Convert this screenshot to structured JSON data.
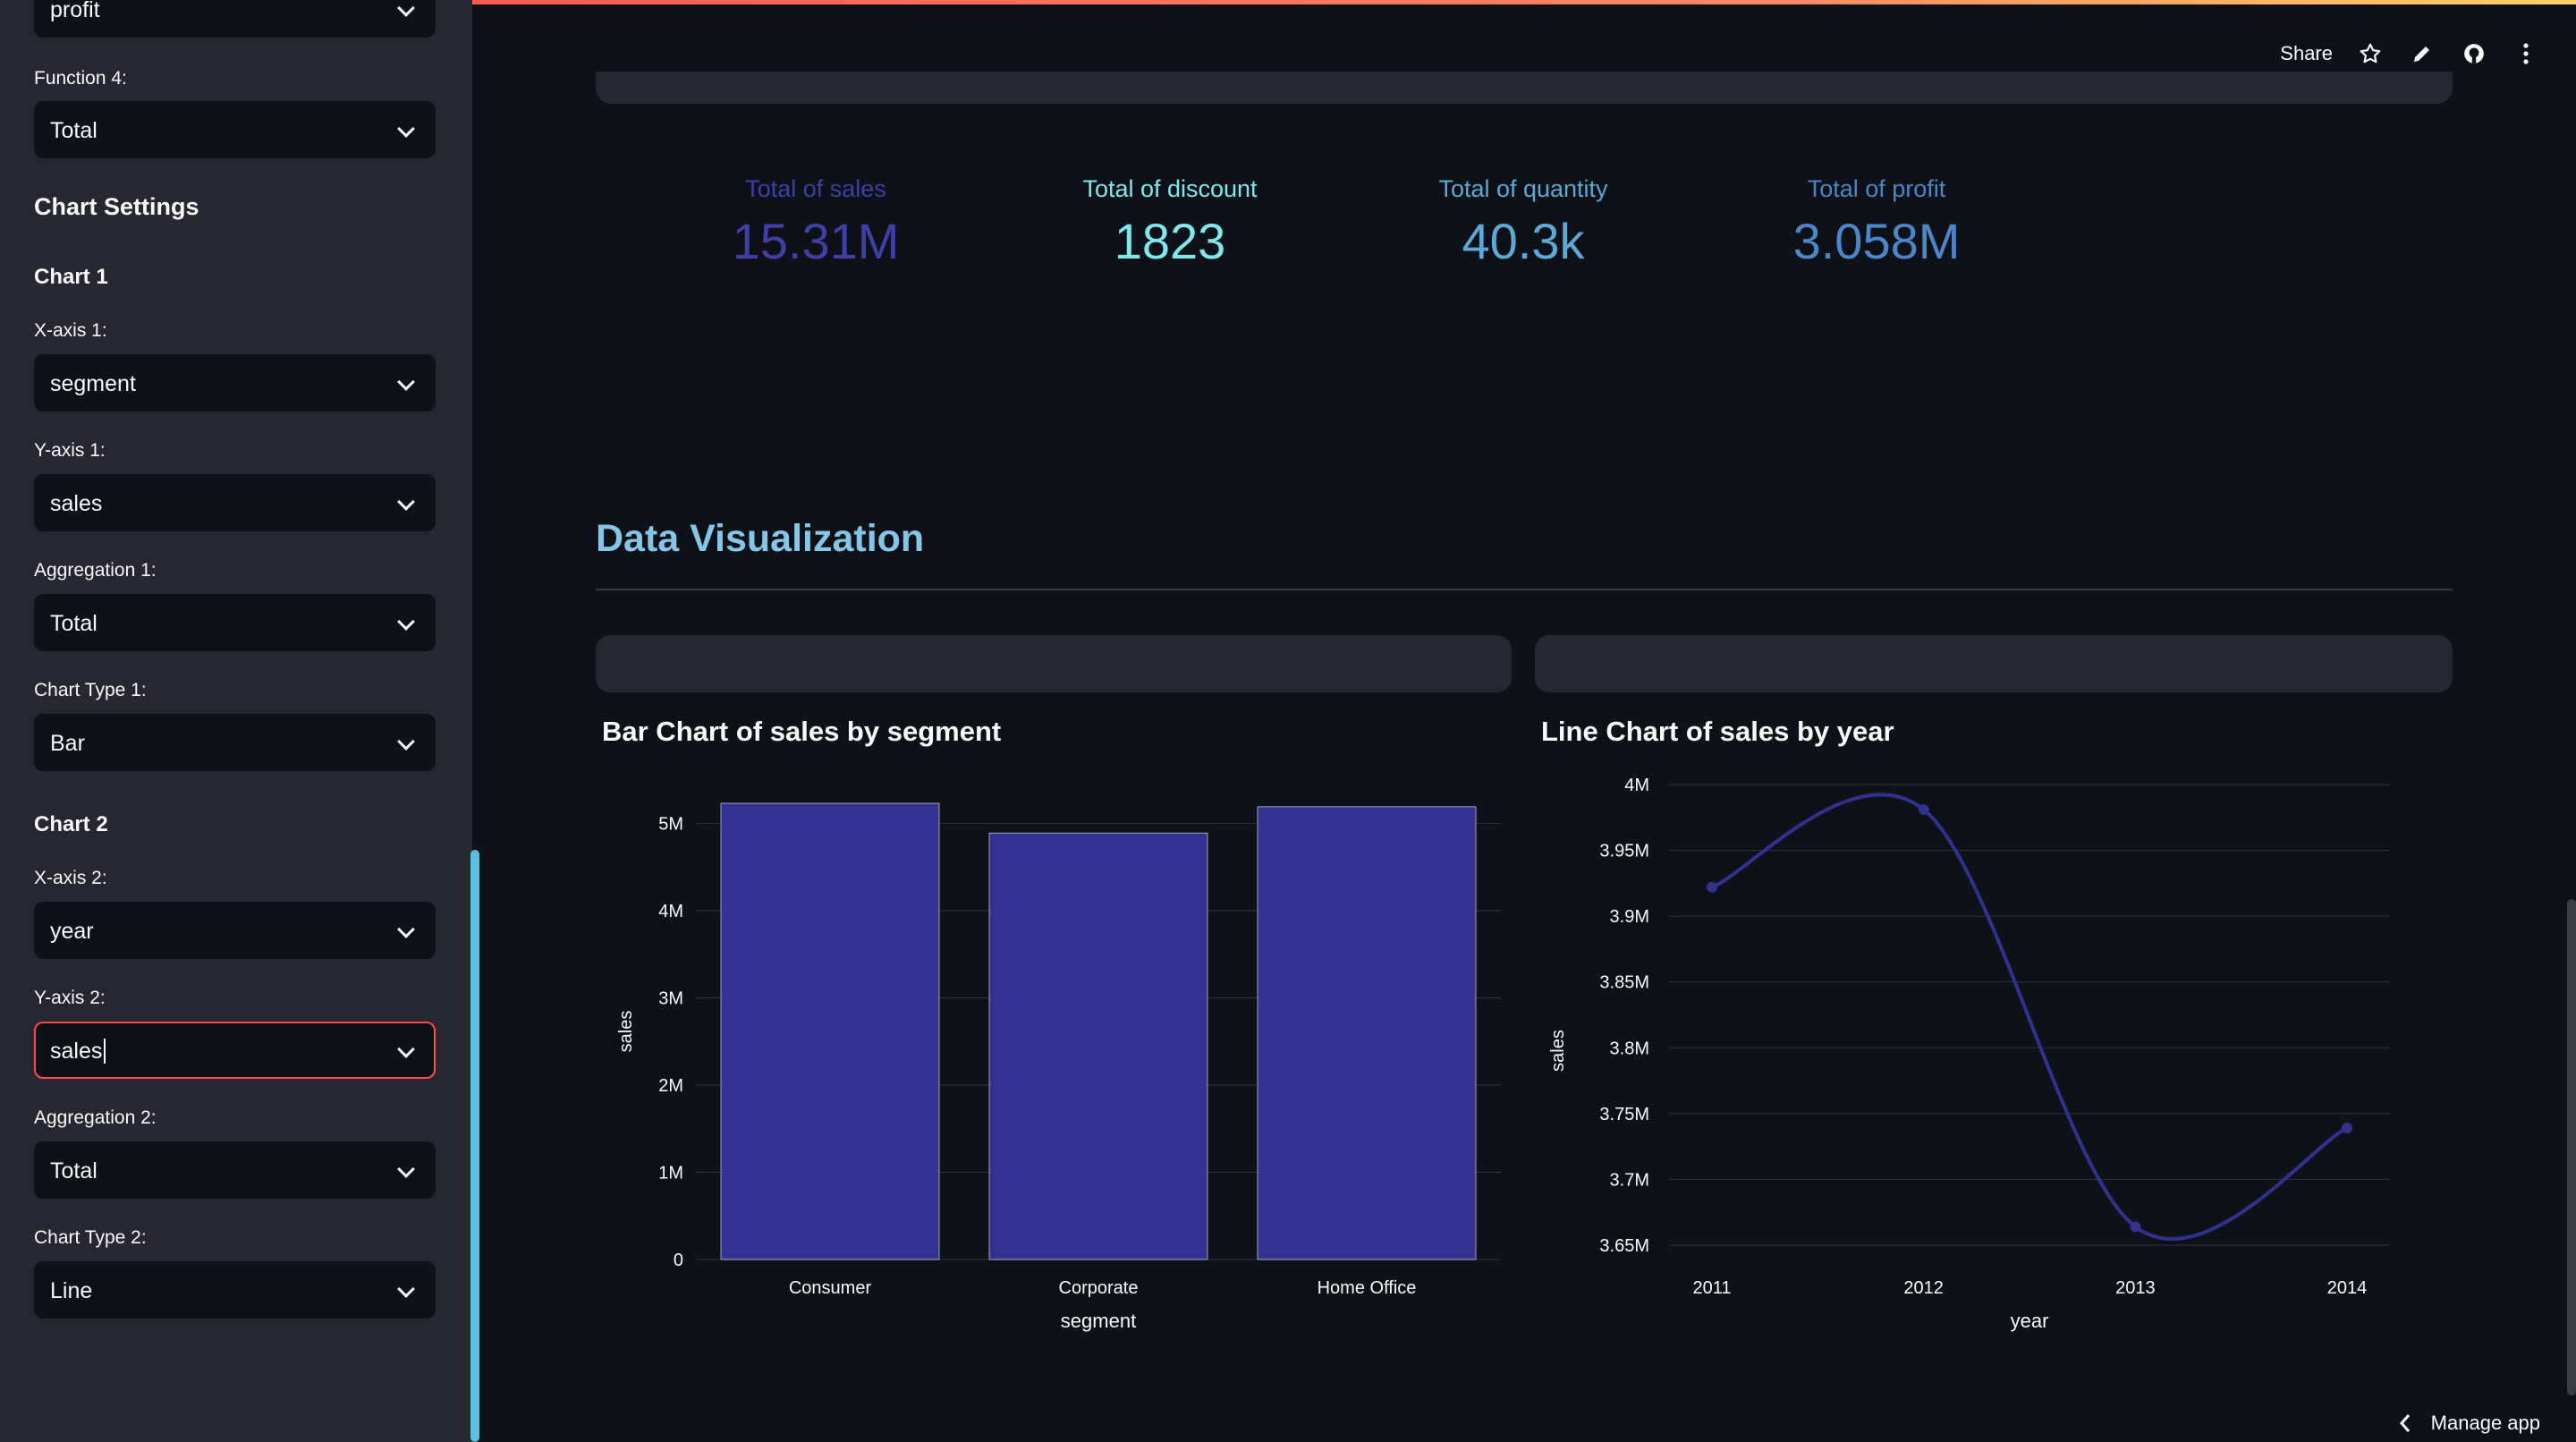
{
  "sidebar": {
    "fields": [
      {
        "label": "",
        "value": "profit"
      },
      {
        "label": "Function 4:",
        "value": "Total"
      }
    ],
    "chart_settings_title": "Chart Settings",
    "chart1": {
      "title": "Chart 1",
      "fields": [
        {
          "label": "X-axis 1:",
          "value": "segment"
        },
        {
          "label": "Y-axis 1:",
          "value": "sales"
        },
        {
          "label": "Aggregation 1:",
          "value": "Total"
        },
        {
          "label": "Chart Type 1:",
          "value": "Bar"
        }
      ]
    },
    "chart2": {
      "title": "Chart 2",
      "fields": [
        {
          "label": "X-axis 2:",
          "value": "year"
        },
        {
          "label": "Y-axis 2:",
          "value": "sales"
        },
        {
          "label": "Aggregation 2:",
          "value": "Total"
        },
        {
          "label": "Chart Type 2:",
          "value": "Line"
        }
      ]
    }
  },
  "header": {
    "share_label": "Share"
  },
  "metrics": [
    {
      "label": "Total of sales",
      "value": "15.31M",
      "color": "#3f3fa8"
    },
    {
      "label": "Total of discount",
      "value": "1823",
      "color": "#7ee8f0"
    },
    {
      "label": "Total of quantity",
      "value": "40.3k",
      "color": "#5aa9d6"
    },
    {
      "label": "Total of profit",
      "value": "3.058M",
      "color": "#4a86c8"
    }
  ],
  "section_title": "Data Visualization",
  "footer": {
    "manage_label": "Manage app"
  },
  "colors": {
    "accent": "#ff4b4b",
    "bar": "#31318f",
    "line": "#31318f",
    "title": "#84c5e8"
  },
  "chart_data": [
    {
      "type": "bar",
      "title": "Bar Chart of sales by segment",
      "xlabel": "segment",
      "ylabel": "sales",
      "categories": [
        "Consumer",
        "Corporate",
        "Home Office"
      ],
      "values": [
        5230000,
        4890000,
        5190000
      ],
      "ylim": [
        0,
        5230000
      ],
      "yticks": [
        0,
        1000000,
        2000000,
        3000000,
        4000000,
        5000000
      ],
      "ytick_labels": [
        "0",
        "1M",
        "2M",
        "3M",
        "4M",
        "5M"
      ],
      "grid": true
    },
    {
      "type": "line",
      "title": "Line Chart of sales by year",
      "xlabel": "year",
      "ylabel": "sales",
      "x": [
        "2011",
        "2012",
        "2013",
        "2014"
      ],
      "values": [
        3922000,
        3981000,
        3664000,
        3739000
      ],
      "ylim": [
        3650000,
        4000000
      ],
      "yticks": [
        3650000,
        3700000,
        3750000,
        3800000,
        3850000,
        3900000,
        3950000,
        4000000
      ],
      "ytick_labels": [
        "3.65M",
        "3.7M",
        "3.75M",
        "3.8M",
        "3.85M",
        "3.9M",
        "3.95M",
        "4M"
      ],
      "smooth": true,
      "grid": true
    }
  ]
}
